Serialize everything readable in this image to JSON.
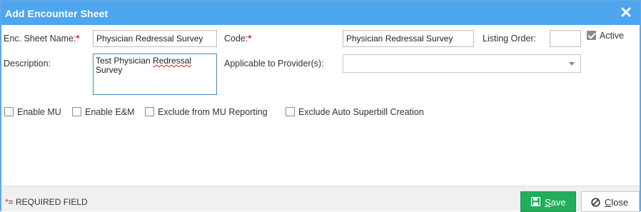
{
  "dialog": {
    "title": "Add Encounter Sheet",
    "close_icon": "close-x-icon"
  },
  "form": {
    "enc_sheet_name_label": "Enc. Sheet Name:",
    "enc_sheet_name_value": "Physician Redressal Survey",
    "code_label": "Code:",
    "code_value": "Physician Redressal Survey",
    "listing_order_label": "Listing Order:",
    "listing_order_value": "",
    "active_label": "Active",
    "active_checked": true,
    "description_label": "Description:",
    "description_line1_pre": "Test Physician ",
    "description_line1_misspelled": "Redressal",
    "description_line2": "Survey",
    "providers_label": "Applicable to Provider(s):",
    "providers_value": "",
    "required_star": "*"
  },
  "options": [
    {
      "label": "Enable MU",
      "checked": false
    },
    {
      "label": "Enable E&M",
      "checked": false
    },
    {
      "label": "Exclude from MU Reporting",
      "checked": false
    },
    {
      "label": "Exclude Auto Superbill Creation",
      "checked": false
    }
  ],
  "footer": {
    "required_star": "*",
    "required_note": "= REQUIRED FIELD",
    "save_icon": "save-icon",
    "save_label_underlined": "S",
    "save_label_rest": "ave",
    "close_icon": "cancel-circle-icon",
    "close_label_underlined": "C",
    "close_label_rest": "lose"
  },
  "colors": {
    "titlebar": "#4ea6ee",
    "save_button": "#22ad5c",
    "required": "#e02020"
  }
}
